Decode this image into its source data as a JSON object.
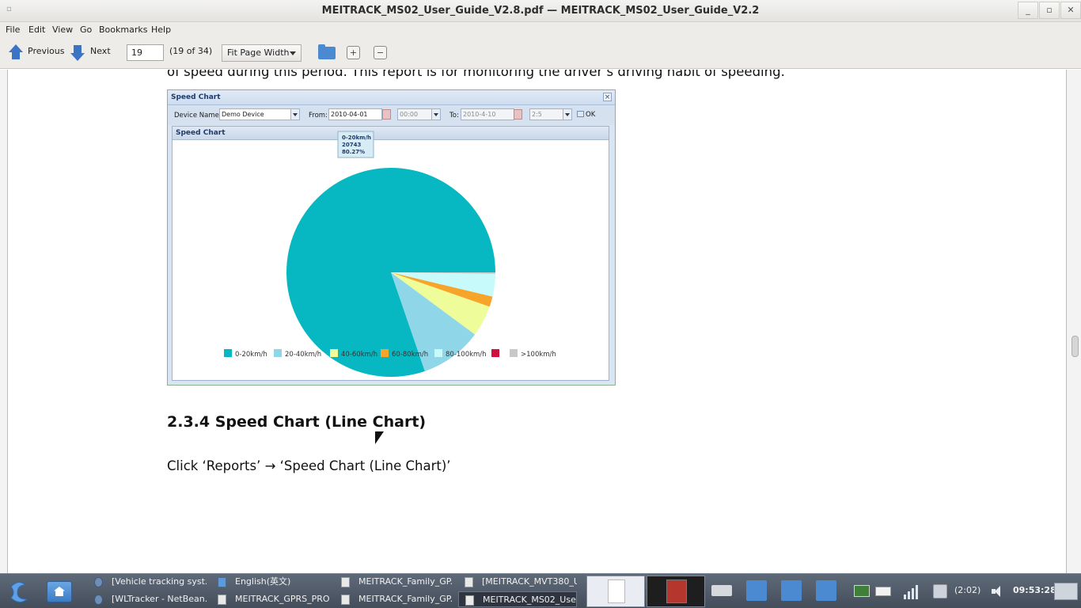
{
  "window": {
    "title": "MEITRACK_MS02_User_Guide_V2.8.pdf — MEITRACK_MS02_User_Guide_V2.2",
    "minimize_label": "_",
    "maximize_label": "▫",
    "close_label": "✕"
  },
  "menu": {
    "items": [
      "File",
      "Edit",
      "View",
      "Go",
      "Bookmarks",
      "Help"
    ]
  },
  "toolbar": {
    "previous_label": "Previous",
    "next_label": "Next",
    "page_value": "19",
    "page_count": "(19 of 34)",
    "zoom_value": "Fit Page Width",
    "zoom_in_label": "+",
    "zoom_out_label": "−"
  },
  "document": {
    "paragraph_top": "of speed during this period. This report is for monitoring the driver’s driving habit of speeding.",
    "heading": "2.3.4 Speed Chart (Line Chart)",
    "instruction": "Click ‘Reports’ → ‘Speed Chart (Line Chart)’"
  },
  "screenshot": {
    "window_title": "Speed Chart",
    "close_label": "×",
    "device_label": "Device Name:",
    "device_value": "Demo Device",
    "from_label": "From:",
    "from_date": "2010-04-01",
    "from_time": "00:00",
    "to_label": "To:",
    "to_date": "2010-4-10",
    "to_time": "2:5",
    "ok_label": "OK",
    "panel_title": "Speed Chart",
    "tooltip": {
      "line1": "0-20km/h",
      "line2": "20743",
      "line3": "80.27%"
    }
  },
  "chart_data": {
    "type": "pie",
    "title": "Speed Chart",
    "labels": [
      "0-20km/h",
      "20-40km/h",
      "40-60km/h",
      "60-80km/h",
      "80-100km/h",
      "",
      ">100km/h"
    ],
    "values": [
      80.27,
      9.6,
      4.8,
      1.6,
      3.5,
      0.0,
      0.23
    ],
    "colors": [
      "#07b7c1",
      "#8fd6e8",
      "#eefc9a",
      "#f7a52a",
      "#c7fbfb",
      "#d0103f",
      "#c8c8c8"
    ],
    "legend_position": "bottom"
  },
  "taskbar": {
    "tasks": [
      {
        "label": "[Vehicle tracking syst...",
        "icon": "globe"
      },
      {
        "label": "English(英文)",
        "icon": "folder"
      },
      {
        "label": "MEITRACK_Family_GP...",
        "icon": "doc"
      },
      {
        "label": "[MEITRACK_MVT380_U...",
        "icon": "doc"
      },
      {
        "label": "[WLTracker - NetBean...",
        "icon": "globe"
      },
      {
        "label": "MEITRACK_GPRS_PRO...",
        "icon": "doc"
      },
      {
        "label": "MEITRACK_Family_GP...",
        "icon": "doc"
      },
      {
        "label": "MEITRACK_MS02_User...",
        "icon": "doc"
      }
    ],
    "battery_text": "(2:02)",
    "clock": "09:53:28"
  }
}
